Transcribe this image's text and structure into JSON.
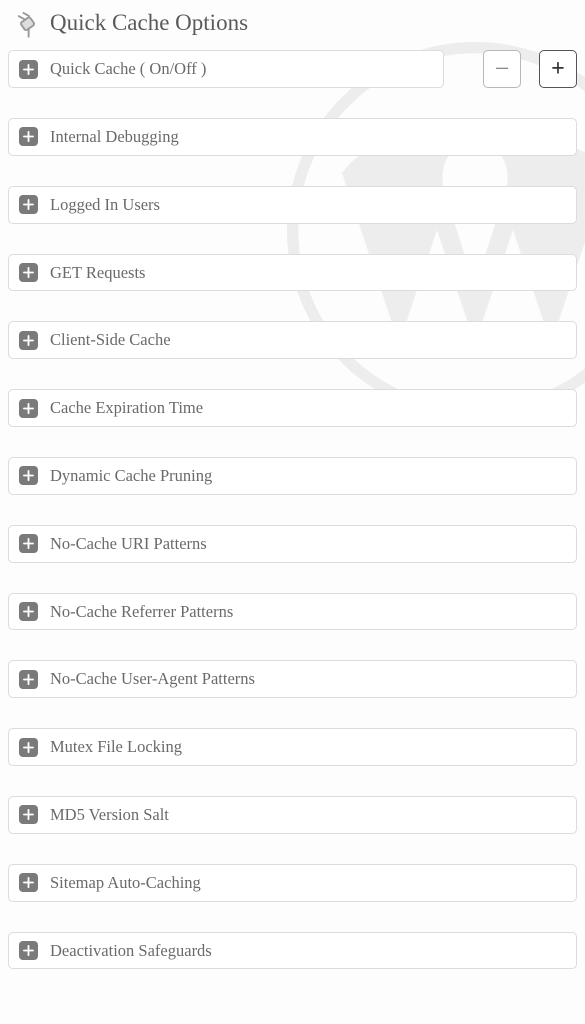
{
  "header": {
    "title": "Quick Cache Options"
  },
  "panels": [
    {
      "label": "Quick Cache ( On/Off )"
    },
    {
      "label": "Internal Debugging"
    },
    {
      "label": "Logged In Users"
    },
    {
      "label": "GET Requests"
    },
    {
      "label": "Client-Side Cache"
    },
    {
      "label": "Cache Expiration Time"
    },
    {
      "label": "Dynamic Cache Pruning"
    },
    {
      "label": "No-Cache URI Patterns"
    },
    {
      "label": "No-Cache Referrer Patterns"
    },
    {
      "label": "No-Cache User-Agent Patterns"
    },
    {
      "label": "Mutex File Locking"
    },
    {
      "label": "MD5 Version Salt"
    },
    {
      "label": "Sitemap Auto-Caching"
    },
    {
      "label": "Deactivation Safeguards"
    }
  ],
  "controls": {
    "collapse_symbol": "−",
    "expand_symbol": "+"
  }
}
